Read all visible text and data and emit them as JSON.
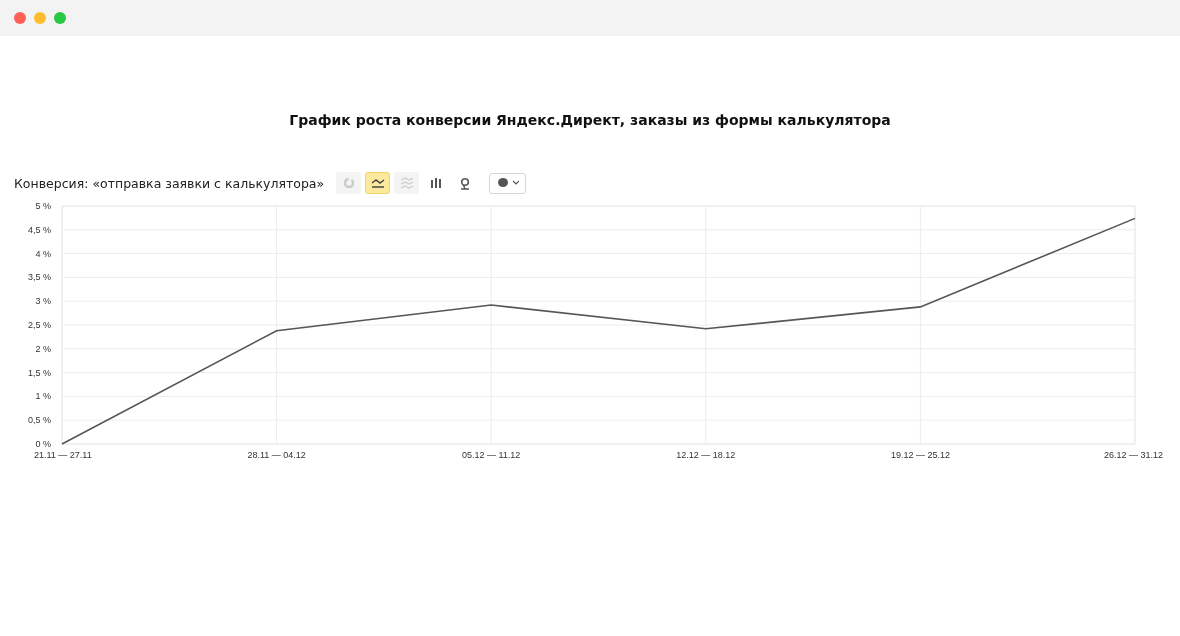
{
  "title": "График роста конверсии Яндекс.Директ, заказы из формы калькулятора",
  "metric_label": "Конверсия: «отправка заявки с калькулятора»",
  "chart_types": [
    {
      "kind": "pie",
      "selected": false,
      "disabled": true
    },
    {
      "kind": "line",
      "selected": true,
      "disabled": false
    },
    {
      "kind": "stacked",
      "selected": false,
      "disabled": true
    },
    {
      "kind": "bar",
      "selected": false,
      "disabled": false
    },
    {
      "kind": "map",
      "selected": false,
      "disabled": false
    }
  ],
  "chart": {
    "chart_data": {
      "type": "line",
      "categories": [
        "21.11 — 27.11",
        "28.11 — 04.12",
        "05.12 — 11.12",
        "12.12 — 18.12",
        "19.12 — 25.12",
        "26.12 — 31.12"
      ],
      "grid": true,
      "series": [
        {
          "color": "#5a5458",
          "values": [
            0,
            2.38,
            2.92,
            2.42,
            2.88,
            4.74
          ]
        }
      ],
      "ylim": [
        0,
        5
      ],
      "yticks": [
        {
          "value": 0,
          "label": "0 %"
        },
        {
          "value": 0.5,
          "label": "0,5 %"
        },
        {
          "value": 1,
          "label": "1 %"
        },
        {
          "value": 1.5,
          "label": "1,5 %"
        },
        {
          "value": 2,
          "label": "2 %"
        },
        {
          "value": 2.5,
          "label": "2,5 %"
        },
        {
          "value": 3,
          "label": "3 %"
        },
        {
          "value": 3.5,
          "label": "3,5 %"
        },
        {
          "value": 4,
          "label": "4 %"
        },
        {
          "value": 4.5,
          "label": "4,5 %"
        },
        {
          "value": 5,
          "label": "5 %"
        }
      ]
    }
  }
}
